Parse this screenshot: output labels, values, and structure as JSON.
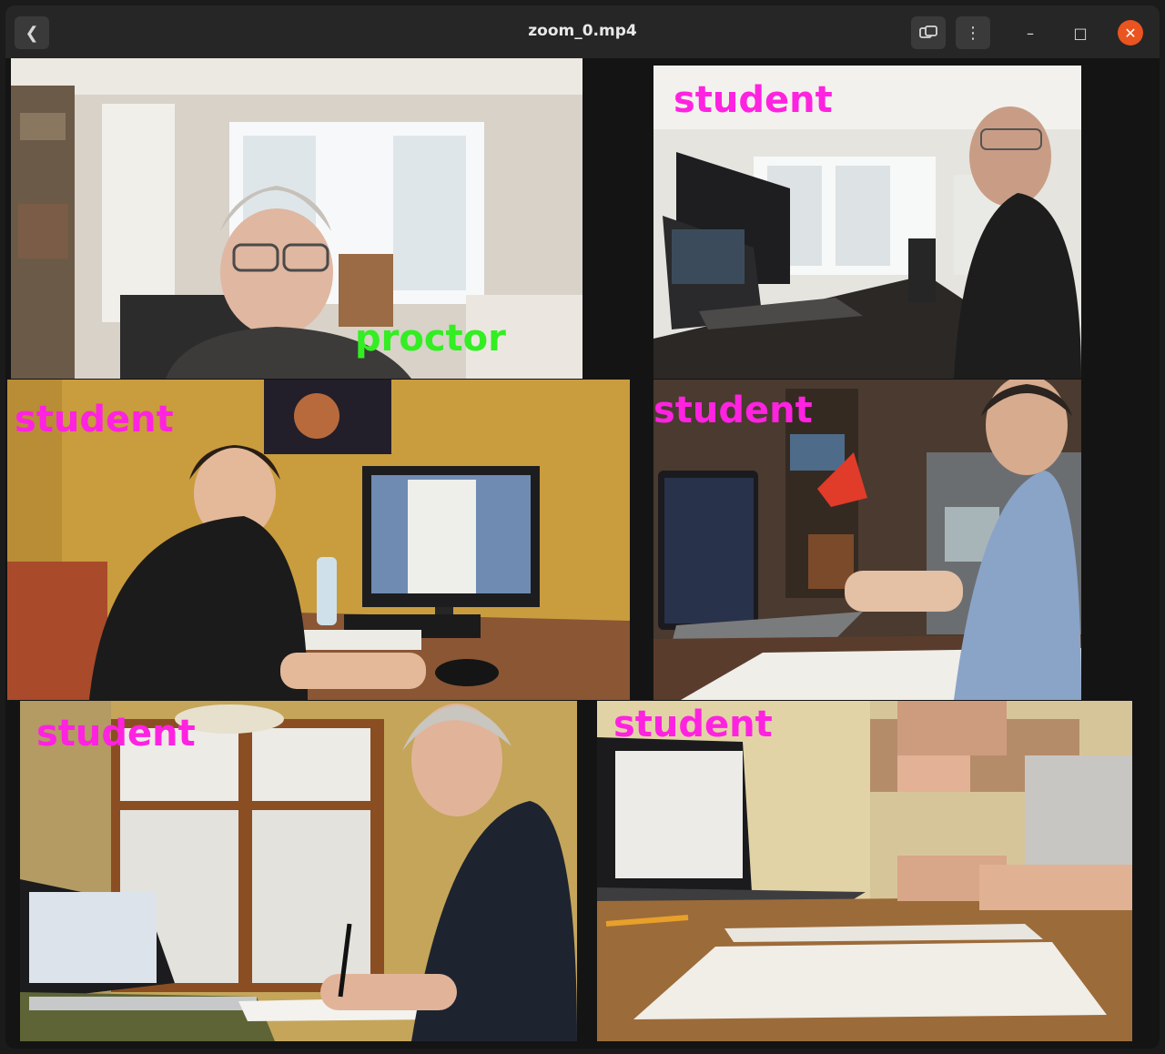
{
  "window": {
    "title": "zoom_0.mp4",
    "buttons": {
      "back_icon": "chevron-left-icon",
      "display_icon": "picture-in-picture-icon",
      "menu_icon": "vertical-ellipsis-icon"
    },
    "controls": {
      "minimize": "–",
      "maximize": "□",
      "close": "✕"
    }
  },
  "colors": {
    "proctor_label": "#33ee22",
    "student_label": "#ff22e0",
    "close_button": "#e95420"
  },
  "tiles": [
    {
      "role": "proctor",
      "label": "proctor"
    },
    {
      "role": "student",
      "label": "student"
    },
    {
      "role": "student",
      "label": "student"
    },
    {
      "role": "student",
      "label": "student"
    },
    {
      "role": "student",
      "label": "student"
    },
    {
      "role": "student",
      "label": "student"
    }
  ]
}
